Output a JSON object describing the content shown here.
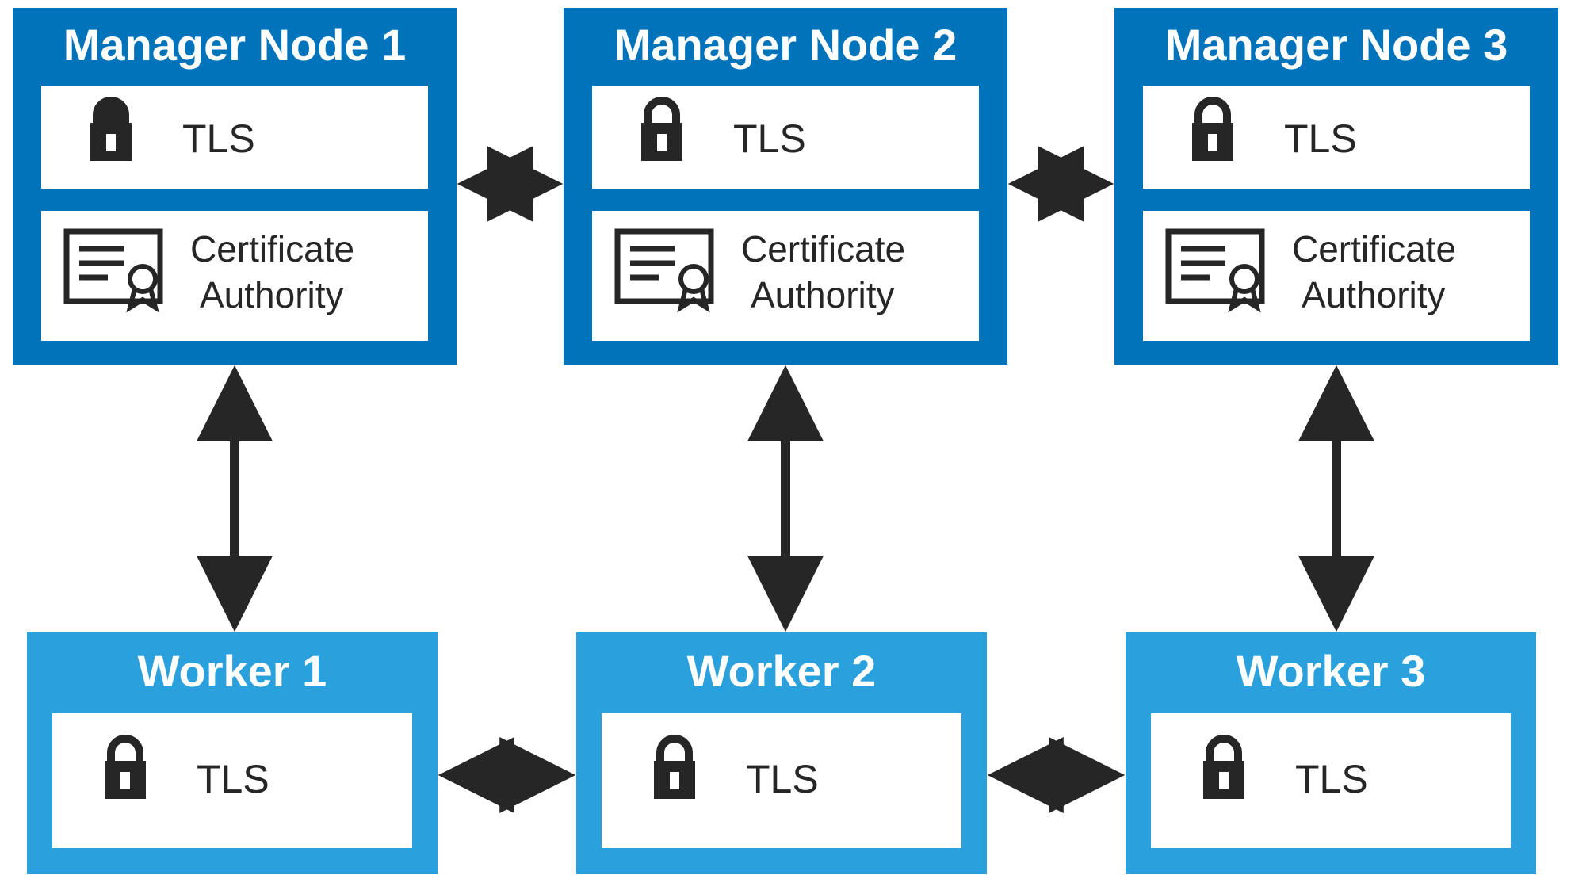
{
  "colors": {
    "managerBlue": "#0073bb",
    "workerBlue": "#2aa1dc",
    "panelWhite": "#ffffff",
    "ink": "#262626"
  },
  "managers": [
    {
      "title": "Manager Node 1",
      "tls": "TLS",
      "ca_line1": "Certificate",
      "ca_line2": "Authority"
    },
    {
      "title": "Manager Node 2",
      "tls": "TLS",
      "ca_line1": "Certificate",
      "ca_line2": "Authority"
    },
    {
      "title": "Manager Node 3",
      "tls": "TLS",
      "ca_line1": "Certificate",
      "ca_line2": "Authority"
    }
  ],
  "workers": [
    {
      "title": "Worker 1",
      "tls": "TLS"
    },
    {
      "title": "Worker 2",
      "tls": "TLS"
    },
    {
      "title": "Worker 3",
      "tls": "TLS"
    }
  ]
}
